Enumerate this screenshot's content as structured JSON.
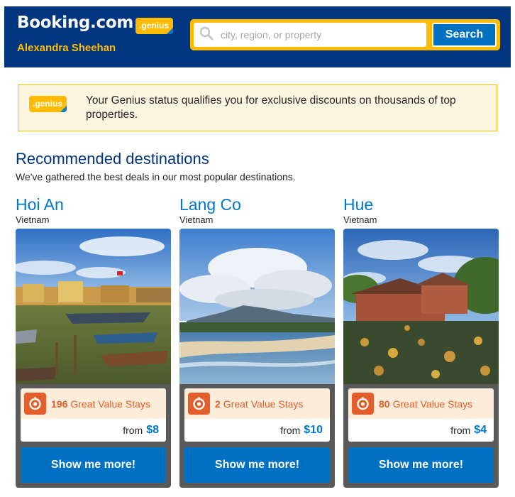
{
  "header": {
    "logo": "Booking.com",
    "genius_badge": ".genius",
    "username": "Alexandra Sheehan",
    "search": {
      "placeholder": "city, region, or property",
      "button_label": "Search"
    }
  },
  "banner": {
    "genius_badge": ".genius",
    "text": "Your Genius status qualifies you for exclusive discounts on thousands of top properties."
  },
  "section": {
    "title": "Recommended destinations",
    "subtitle": "We've gathered the best deals in our most popular destinations."
  },
  "destinations": [
    {
      "city": "Hoi An",
      "country": "Vietnam",
      "stays_count": "196",
      "stays_label": "Great Value Stays",
      "price_prefix": "from",
      "price": "$8",
      "button_label": "Show me more!"
    },
    {
      "city": "Lang Co",
      "country": "Vietnam",
      "stays_count": "2",
      "stays_label": "Great Value Stays",
      "price_prefix": "from",
      "price": "$10",
      "button_label": "Show me more!"
    },
    {
      "city": "Hue",
      "country": "Vietnam",
      "stays_count": "80",
      "stays_label": "Great Value Stays",
      "price_prefix": "from",
      "price": "$4",
      "button_label": "Show me more!"
    }
  ],
  "colors": {
    "brand_blue": "#003580",
    "accent_yellow": "#febb02",
    "link_blue": "#0077cc",
    "button_blue": "#0071c2",
    "deal_orange": "#e35e2a"
  },
  "icons": [
    "search-icon",
    "deal-badge-icon"
  ]
}
